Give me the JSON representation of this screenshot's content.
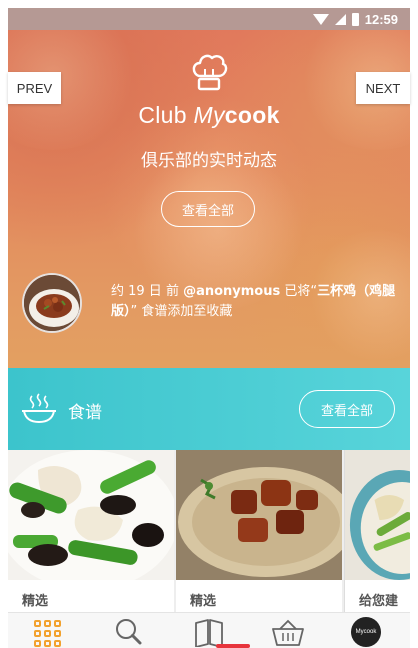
{
  "status_bar": {
    "time": "12:59",
    "icons": [
      "wifi-icon",
      "cell-signal-icon",
      "battery-icon"
    ]
  },
  "hero": {
    "brand_club": "Club ",
    "brand_my": "My",
    "brand_cook": "cook",
    "subtitle": "俱乐部的实时动态",
    "view_all_label": "查看全部",
    "prev_label": "PREV",
    "next_label": "NEXT",
    "activity": {
      "time_prefix": "约 19 日 前 ",
      "user": "@anonymous",
      "action": " 已将“",
      "recipe": "三杯鸡（鸡腿版）",
      "suffix": "” 食谱添加至收藏"
    }
  },
  "recipes": {
    "title": "食谱",
    "view_all_label": "查看全部",
    "cards": [
      {
        "tag": "精选"
      },
      {
        "tag": "精选"
      },
      {
        "tag": "给您建议"
      }
    ]
  },
  "bottom_nav": {
    "tabs": [
      "grid-menu-icon",
      "search-icon",
      "book-icon",
      "basket-icon",
      "mycook-profile-icon"
    ],
    "profile_badge": "Mycook"
  },
  "colors": {
    "hero_orange": "#e3895e",
    "recipe_teal": "#3cc4cc",
    "accent_yellow": "#f2a12e",
    "accent_red": "#e7343c"
  }
}
